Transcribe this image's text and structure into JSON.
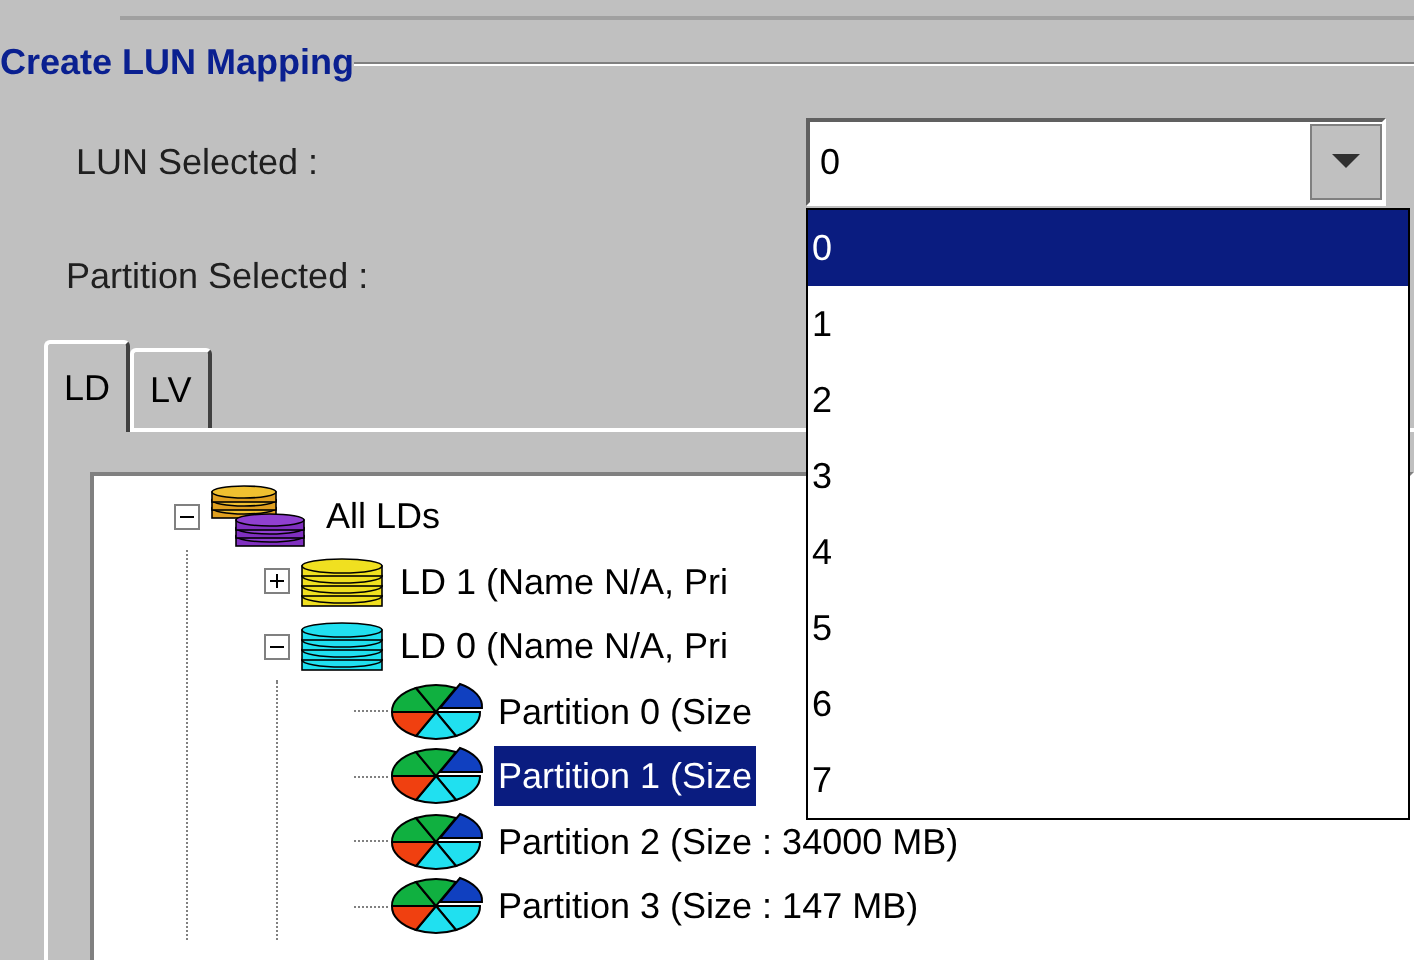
{
  "group": {
    "title": "Create LUN Mapping"
  },
  "lun": {
    "label": "LUN Selected :",
    "value": "0",
    "expanded": true,
    "options": [
      {
        "label": "0",
        "selected": true
      },
      {
        "label": "1",
        "selected": false
      },
      {
        "label": "2",
        "selected": false
      },
      {
        "label": "3",
        "selected": false
      },
      {
        "label": "4",
        "selected": false
      },
      {
        "label": "5",
        "selected": false
      },
      {
        "label": "6",
        "selected": false
      },
      {
        "label": "7",
        "selected": false
      }
    ]
  },
  "partition": {
    "label": "Partition Selected :"
  },
  "tabs": [
    {
      "label": "LD",
      "selected": true
    },
    {
      "label": "LV",
      "selected": false
    }
  ],
  "tree": [
    {
      "label": "All LDs",
      "kind": "all",
      "expanded": true,
      "selected": false,
      "children": [
        {
          "label": "LD 1 (Name N/A, Pri",
          "kind": "ld",
          "color": "#f0e020",
          "expanded": false,
          "selected": false
        },
        {
          "label": "LD 0 (Name N/A, Pri",
          "kind": "ld",
          "color": "#20e0f0",
          "expanded": true,
          "selected": false,
          "children": [
            {
              "label": "Partition 0 (Size",
              "kind": "partition",
              "selected": false
            },
            {
              "label": "Partition 1 (Size",
              "kind": "partition",
              "selected": true
            },
            {
              "label": "Partition 2 (Size : 34000 MB)",
              "kind": "partition",
              "selected": false
            },
            {
              "label": "Partition 3 (Size : 147 MB)",
              "kind": "partition",
              "selected": false
            }
          ]
        }
      ]
    }
  ]
}
